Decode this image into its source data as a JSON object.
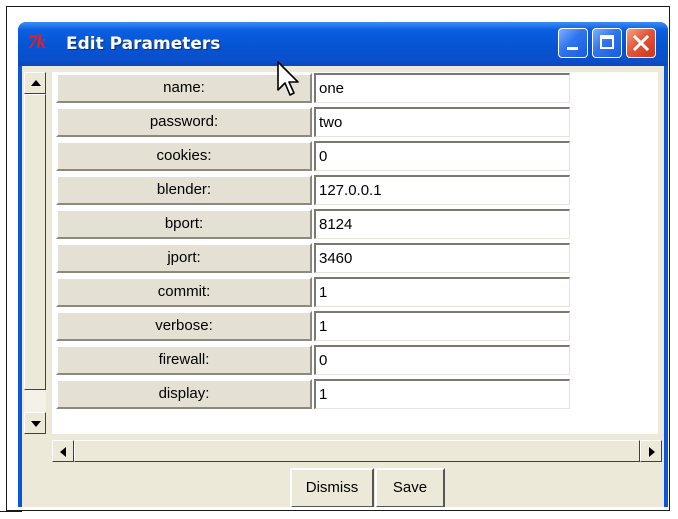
{
  "window": {
    "title": "Edit Parameters",
    "logo_text": "7k",
    "logo_color": "#e8201c",
    "titlebar_color": "#0654d4"
  },
  "titlebar_buttons": [
    {
      "name": "minimize",
      "icon": "minimize-icon"
    },
    {
      "name": "maximize",
      "icon": "maximize-icon"
    },
    {
      "name": "close",
      "icon": "close-icon"
    }
  ],
  "parameters": [
    {
      "label": "name:",
      "value": "one"
    },
    {
      "label": "password:",
      "value": "two"
    },
    {
      "label": "cookies:",
      "value": "0"
    },
    {
      "label": "blender:",
      "value": "127.0.0.1"
    },
    {
      "label": "bport:",
      "value": "8124"
    },
    {
      "label": "jport:",
      "value": "3460"
    },
    {
      "label": "commit:",
      "value": "1"
    },
    {
      "label": "verbose:",
      "value": "1"
    },
    {
      "label": "firewall:",
      "value": "0"
    },
    {
      "label": "display:",
      "value": "1"
    }
  ],
  "buttons": {
    "dismiss_label": "Dismiss",
    "save_label": "Save"
  },
  "icons": {
    "scroll_up": "arrow-up-icon",
    "scroll_down": "arrow-down-icon",
    "scroll_left": "arrow-left-icon",
    "scroll_right": "arrow-right-icon",
    "cursor": "mouse-pointer-icon"
  }
}
